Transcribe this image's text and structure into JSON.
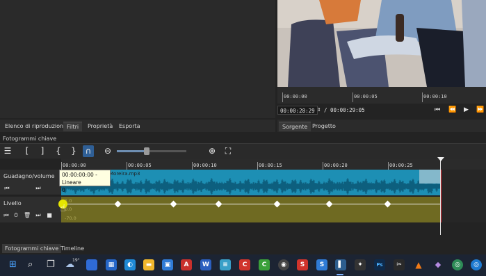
{
  "player": {
    "ruler_labels": [
      "00:00:00",
      "00:00:05",
      "00:00:10"
    ],
    "current_timecode": "00:00:28:29",
    "total_duration": "/ 00:00:29:05"
  },
  "tabs_left": [
    "Elenco di riproduzione",
    "Filtri",
    "Proprietà",
    "Esporta"
  ],
  "tabs_right": [
    "Sorgente",
    "Progetto"
  ],
  "panel_title": "Fotogrammi chiave",
  "timeline": {
    "ruler_labels": [
      "00:00:00",
      "00:00:05",
      "00:00:10",
      "00:00:15",
      "00:00:20",
      "00:00:25"
    ]
  },
  "tracks": {
    "gain_title": "Guadagno/volume",
    "gain_clip_label": "cas Moreira.mp3",
    "level_title": "Livello",
    "level_scale": [
      "1.0",
      "0.0",
      "-70.0"
    ]
  },
  "tooltip": {
    "line1": "00:00:00:00 - Lineare",
    "line2": "0"
  },
  "bottom_tabs": [
    "Fotogrammi chiave",
    "Timeline"
  ],
  "taskbar": {
    "weather_temp": "19°"
  },
  "colors": {
    "gain_track": "#1d8fb4",
    "level_track": "#6f6a22",
    "playhead": "#e0303a",
    "keyframe_selected": "#e6e600"
  }
}
